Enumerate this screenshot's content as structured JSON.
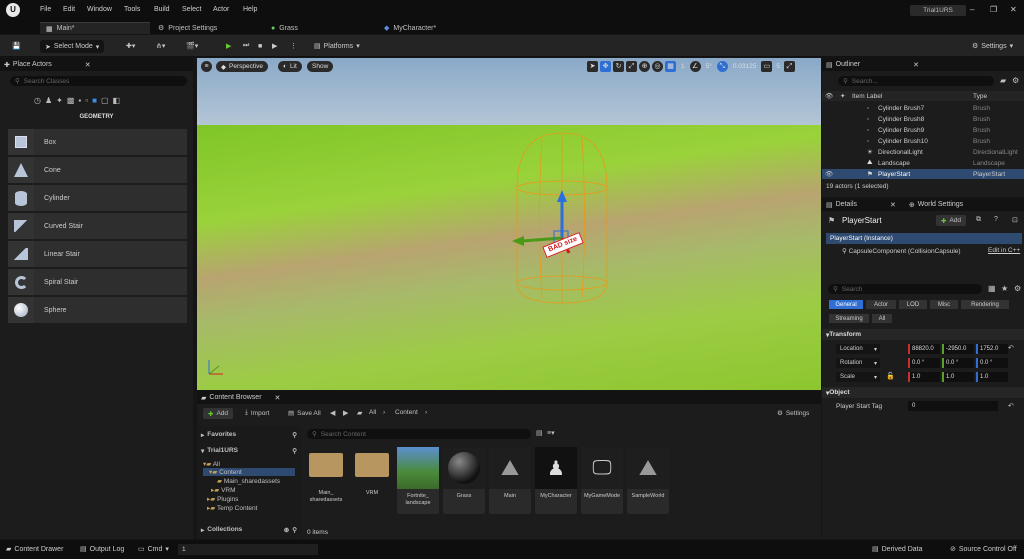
{
  "menubar": {
    "items": [
      "File",
      "Edit",
      "Window",
      "Tools",
      "Build",
      "Select",
      "Actor",
      "Help"
    ],
    "project": "Trial1URS"
  },
  "tabs": [
    {
      "label": "Main*",
      "icon": "level-icon"
    },
    {
      "label": "Project Settings",
      "icon": "settings-icon"
    },
    {
      "label": "Grass",
      "icon": "material-icon"
    },
    {
      "label": "MyCharacter*",
      "icon": "blueprint-icon"
    }
  ],
  "toolbar": {
    "mode": "Select Mode",
    "platforms": "Platforms",
    "settings": "Settings"
  },
  "place_actors": {
    "title": "Place Actors",
    "search_placeholder": "Search Classes",
    "category": "GEOMETRY",
    "items": [
      "Box",
      "Cone",
      "Cylinder",
      "Curved Stair",
      "Linear Stair",
      "Spiral Stair",
      "Sphere"
    ]
  },
  "viewport": {
    "perspective": "Perspective",
    "lit": "Lit",
    "show": "Show",
    "grid_snap": "1",
    "angle_snap": "5°",
    "scale_snap": "0.03125",
    "camera_speed": "5",
    "billboard_text": "BAD size",
    "accent": "#7fc628"
  },
  "outliner": {
    "title": "Outliner",
    "search_placeholder": "Search...",
    "col_label": "Item Label",
    "col_type": "Type",
    "rows": [
      {
        "name": "Cylinder Brush7",
        "type": "Brush"
      },
      {
        "name": "Cylinder Brush8",
        "type": "Brush"
      },
      {
        "name": "Cylinder Brush9",
        "type": "Brush"
      },
      {
        "name": "Cylinder Brush10",
        "type": "Brush"
      },
      {
        "name": "DirectionalLight",
        "type": "DirectionalLight"
      },
      {
        "name": "Landscape",
        "type": "Landscape"
      },
      {
        "name": "PlayerStart",
        "type": "PlayerStart"
      }
    ],
    "status": "19 actors (1 selected)"
  },
  "details": {
    "tab": "Details",
    "tab2": "World Settings",
    "actor_name": "PlayerStart",
    "add": "Add",
    "instance": "PlayerStart (Instance)",
    "component": "CapsuleComponent (CollisionCapsule)",
    "edit_cpp": "Edit in C++",
    "search_placeholder": "Search",
    "categories": [
      "General",
      "Actor",
      "LOD",
      "Misc",
      "Rendering",
      "Streaming",
      "All"
    ],
    "transform_title": "Transform",
    "location_label": "Location",
    "rotation_label": "Rotation",
    "scale_label": "Scale",
    "location": [
      "88820.0",
      "-2950.0",
      "1752.0"
    ],
    "rotation": [
      "0.0 °",
      "0.0 °",
      "0.0 °"
    ],
    "scale": [
      "1.0",
      "1.0",
      "1.0"
    ],
    "object_title": "Object",
    "tag_label": "Player Start Tag",
    "tag_value": "0"
  },
  "content_browser": {
    "title": "Content Browser",
    "add": "Add",
    "import": "Import",
    "save_all": "Save All",
    "path_all": "All",
    "path_content": "Content",
    "settings": "Settings",
    "favorites": "Favorites",
    "project": "Trial1URS",
    "search_placeholder": "Search Content",
    "tree": [
      "All",
      "Content",
      "Main_sharedassets",
      "VRM",
      "Plugins",
      "Temp Content"
    ],
    "collections": "Collections",
    "items_count": "0 items",
    "assets": [
      {
        "label": "Main_\nsharedassets",
        "kind": "folder"
      },
      {
        "label": "VRM",
        "kind": "folder"
      },
      {
        "label": "Fortnite_\nlandscape",
        "kind": "texture"
      },
      {
        "label": "Grass",
        "kind": "material"
      },
      {
        "label": "Main",
        "kind": "level"
      },
      {
        "label": "MyCharacter",
        "kind": "blueprint"
      },
      {
        "label": "MyGameMode",
        "kind": "blueprint"
      },
      {
        "label": "SampleWorld",
        "kind": "level"
      }
    ]
  },
  "statusbar": {
    "content_drawer": "Content Drawer",
    "output_log": "Output Log",
    "cmd": "Cmd",
    "cmd_value": "1",
    "derived_data": "Derived Data",
    "source_control": "Source Control Off"
  }
}
